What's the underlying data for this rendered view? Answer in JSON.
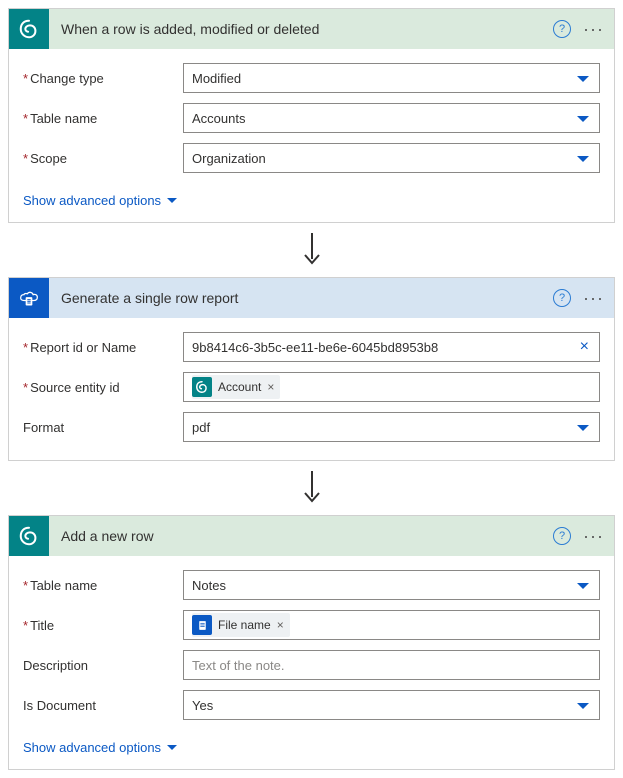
{
  "card1": {
    "title": "When a row is added, modified or deleted",
    "change_type_label": "Change type",
    "change_type_value": "Modified",
    "table_name_label": "Table name",
    "table_name_value": "Accounts",
    "scope_label": "Scope",
    "scope_value": "Organization",
    "advanced": "Show advanced options"
  },
  "card2": {
    "title": "Generate a single row report",
    "report_label": "Report id or Name",
    "report_value": "9b8414c6-3b5c-ee11-be6e-6045bd8953b8",
    "source_label": "Source entity id",
    "source_pill": "Account",
    "format_label": "Format",
    "format_value": "pdf"
  },
  "card3": {
    "title": "Add a new row",
    "table_name_label": "Table name",
    "table_name_value": "Notes",
    "title_label": "Title",
    "title_pill": "File name",
    "description_label": "Description",
    "description_placeholder": "Text of the note.",
    "isdoc_label": "Is Document",
    "isdoc_value": "Yes",
    "advanced": "Show advanced options"
  }
}
